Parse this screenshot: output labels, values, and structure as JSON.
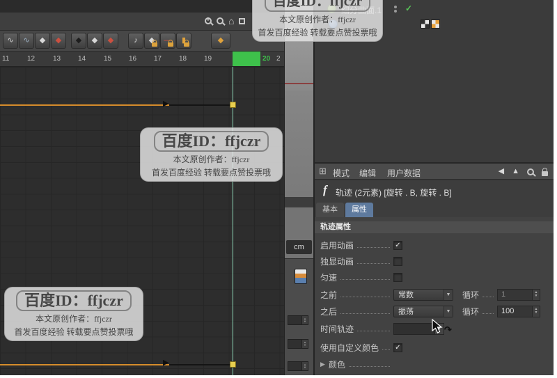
{
  "glyphs": {
    "check": "✓",
    "dropdown_arrow": "▼",
    "spin_up": "▲",
    "spin_down": "▼",
    "nav_back": "◀",
    "nav_up": "▲",
    "expander": "▶",
    "home_icon": "⌂",
    "grid_icon": "⊞",
    "note_icon": "♪",
    "key_icon": "◆",
    "wave_icon": "∿",
    "bar_icon": "▮",
    "dash_icon": "—",
    "curve_marker": "▶",
    "curl_cursor": "↷"
  },
  "colors": {
    "range_green": "#3ec14b",
    "playhead_line": "#8fd8b8",
    "curve_orange": "#d68c2b",
    "key_yellow": "#e8cf4f",
    "tab_active_bg": "#5e7a9e",
    "check_green": "#58c858"
  },
  "watermark": {
    "line1": "百度ID：ffjczr",
    "line2": "本文原创作者：ffjczr",
    "line3": "首发百度经验 转载要点赞投票哦"
  },
  "timeline": {
    "ruler_frames": [
      "11",
      "12",
      "13",
      "14",
      "15",
      "16",
      "17",
      "18",
      "19"
    ],
    "ruler_highlight": "20",
    "ruler_partial": "2"
  },
  "viewport": {
    "unit": "cm"
  },
  "object_manager": {
    "item1_label": "细分曲面.1"
  },
  "panel": {
    "menu_mode": "模式",
    "menu_edit": "编辑",
    "menu_userdata": "用户数据",
    "object_icon": "f",
    "object_title": "轨迹 (2元素) [旋转 . B, 旋转 . B]",
    "tab_basic": "基本",
    "tab_attr": "属性",
    "section_title": "轨迹属性",
    "row_enable": "启用动画",
    "row_solo": "独显动画",
    "row_constant": "匀速",
    "row_before": "之前",
    "before_value": "常数",
    "row_loop": "循环",
    "before_loop_value": "1",
    "row_after": "之后",
    "after_value": "振荡",
    "after_loop_value": "100",
    "row_timetrack": "时间轨迹",
    "row_customcolor": "使用自定义颜色",
    "row_color": "颜色"
  }
}
